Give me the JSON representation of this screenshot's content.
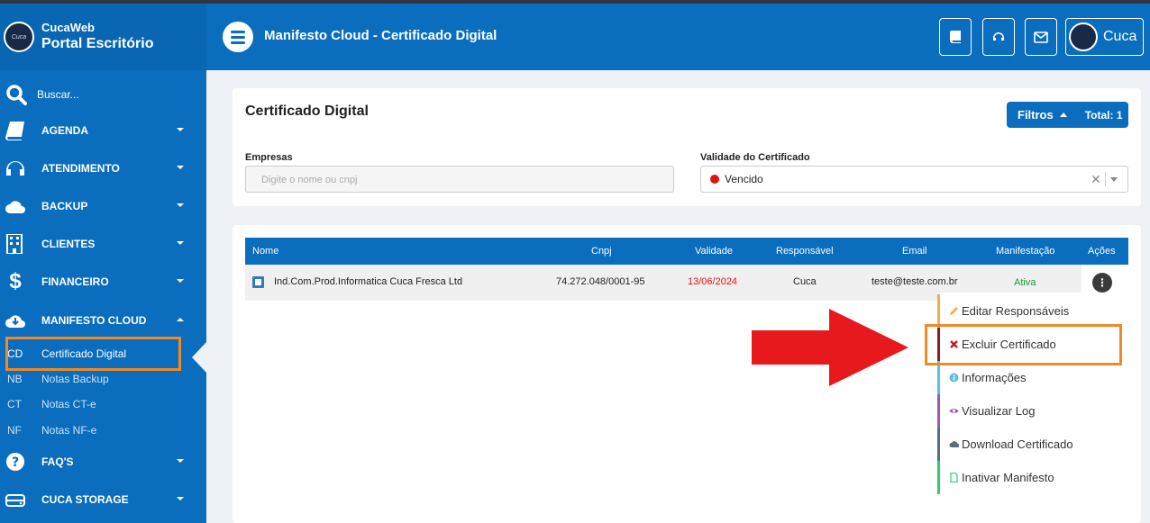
{
  "brand": {
    "subtitle": "CucaWeb",
    "name": "Portal Escritório"
  },
  "header": {
    "title": "Manifesto Cloud - Certificado Digital",
    "user_name": "Cuca"
  },
  "sidebar": {
    "search_placeholder": "Buscar...",
    "items": [
      {
        "label": "AGENDA",
        "icon": "book-icon"
      },
      {
        "label": "ATENDIMENTO",
        "icon": "headset-icon"
      },
      {
        "label": "BACKUP",
        "icon": "cloud-icon"
      },
      {
        "label": "CLIENTES",
        "icon": "building-icon"
      },
      {
        "label": "FINANCEIRO",
        "icon": "dollar-icon"
      },
      {
        "label": "MANIFESTO CLOUD",
        "icon": "cloud-download-icon"
      },
      {
        "label": "FAQ'S",
        "icon": "question-icon"
      },
      {
        "label": "CUCA STORAGE",
        "icon": "hdd-icon"
      }
    ],
    "subitems": [
      {
        "abbr": "CD",
        "label": "Certificado Digital"
      },
      {
        "abbr": "NB",
        "label": "Notas Backup"
      },
      {
        "abbr": "CT",
        "label": "Notas CT-e"
      },
      {
        "abbr": "NF",
        "label": "Notas NF-e"
      }
    ]
  },
  "filter": {
    "title": "Certificado Digital",
    "filters_label": "Filtros",
    "total_label": "Total: 1",
    "empresas_label": "Empresas",
    "empresas_placeholder": "Digite o nome ou cnpj",
    "validade_label": "Validade do Certificado",
    "validade_value": "Vencido"
  },
  "table": {
    "headers": [
      "Nome",
      "Cnpj",
      "Validade",
      "Responsável",
      "Email",
      "Manifestação",
      "Ações"
    ],
    "rows": [
      {
        "nome": "Ind.Com.Prod.Informatica Cuca Fresca Ltd",
        "cnpj": "74.272.048/0001-95",
        "validade": "13/06/2024",
        "responsavel": "Cuca",
        "email": "teste@teste.com.br",
        "manifestacao": "Ativa"
      }
    ]
  },
  "actions_menu": [
    {
      "label": "Editar Responsáveis",
      "icon": "pencil-icon",
      "color": "#f0ad4e"
    },
    {
      "label": "Excluir Certificado",
      "icon": "x-icon",
      "color": "#8b1a2b"
    },
    {
      "label": "Informações",
      "icon": "info-icon",
      "color": "#5bc0de"
    },
    {
      "label": "Visualizar Log",
      "icon": "eye-icon",
      "color": "#9b59b6"
    },
    {
      "label": "Download Certificado",
      "icon": "cloud-download-icon",
      "color": "#5a6b7a"
    },
    {
      "label": "Inativar Manifesto",
      "icon": "file-icon",
      "color": "#2ecc71"
    }
  ],
  "colors": {
    "primary": "#0a6dbd",
    "highlight": "#f08a24",
    "arrow": "#e8191c",
    "danger": "#e3120b",
    "success": "#1a9c3e"
  }
}
